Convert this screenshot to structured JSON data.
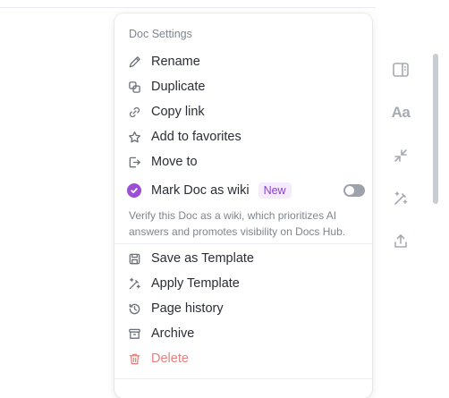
{
  "menu": {
    "title": "Doc Settings",
    "items": [
      {
        "label": "Rename",
        "icon": "pencil-icon"
      },
      {
        "label": "Duplicate",
        "icon": "duplicate-icon"
      },
      {
        "label": "Copy link",
        "icon": "link-icon"
      },
      {
        "label": "Add to favorites",
        "icon": "star-icon"
      },
      {
        "label": "Move to",
        "icon": "move-icon"
      }
    ],
    "wiki": {
      "label": "Mark Doc as wiki",
      "badge": "New",
      "enabled": false,
      "description": "Verify this Doc as a wiki, which prioritizes AI answers and promotes visibility on Docs Hub."
    },
    "items2": [
      {
        "label": "Save as Template",
        "icon": "template-save-icon"
      },
      {
        "label": "Apply Template",
        "icon": "magic-wand-icon"
      },
      {
        "label": "Page history",
        "icon": "history-icon"
      },
      {
        "label": "Archive",
        "icon": "archive-icon"
      },
      {
        "label": "Delete",
        "icon": "trash-icon"
      }
    ]
  },
  "rail": {
    "font_label": "Aa",
    "icons": [
      "sidebar-panel-icon",
      "font-icon",
      "collapse-arrows-icon",
      "magic-wand-icon",
      "share-icon"
    ]
  },
  "colors": {
    "accent": "#9b4fd4",
    "danger": "#e8807d",
    "muted": "#80858e"
  }
}
